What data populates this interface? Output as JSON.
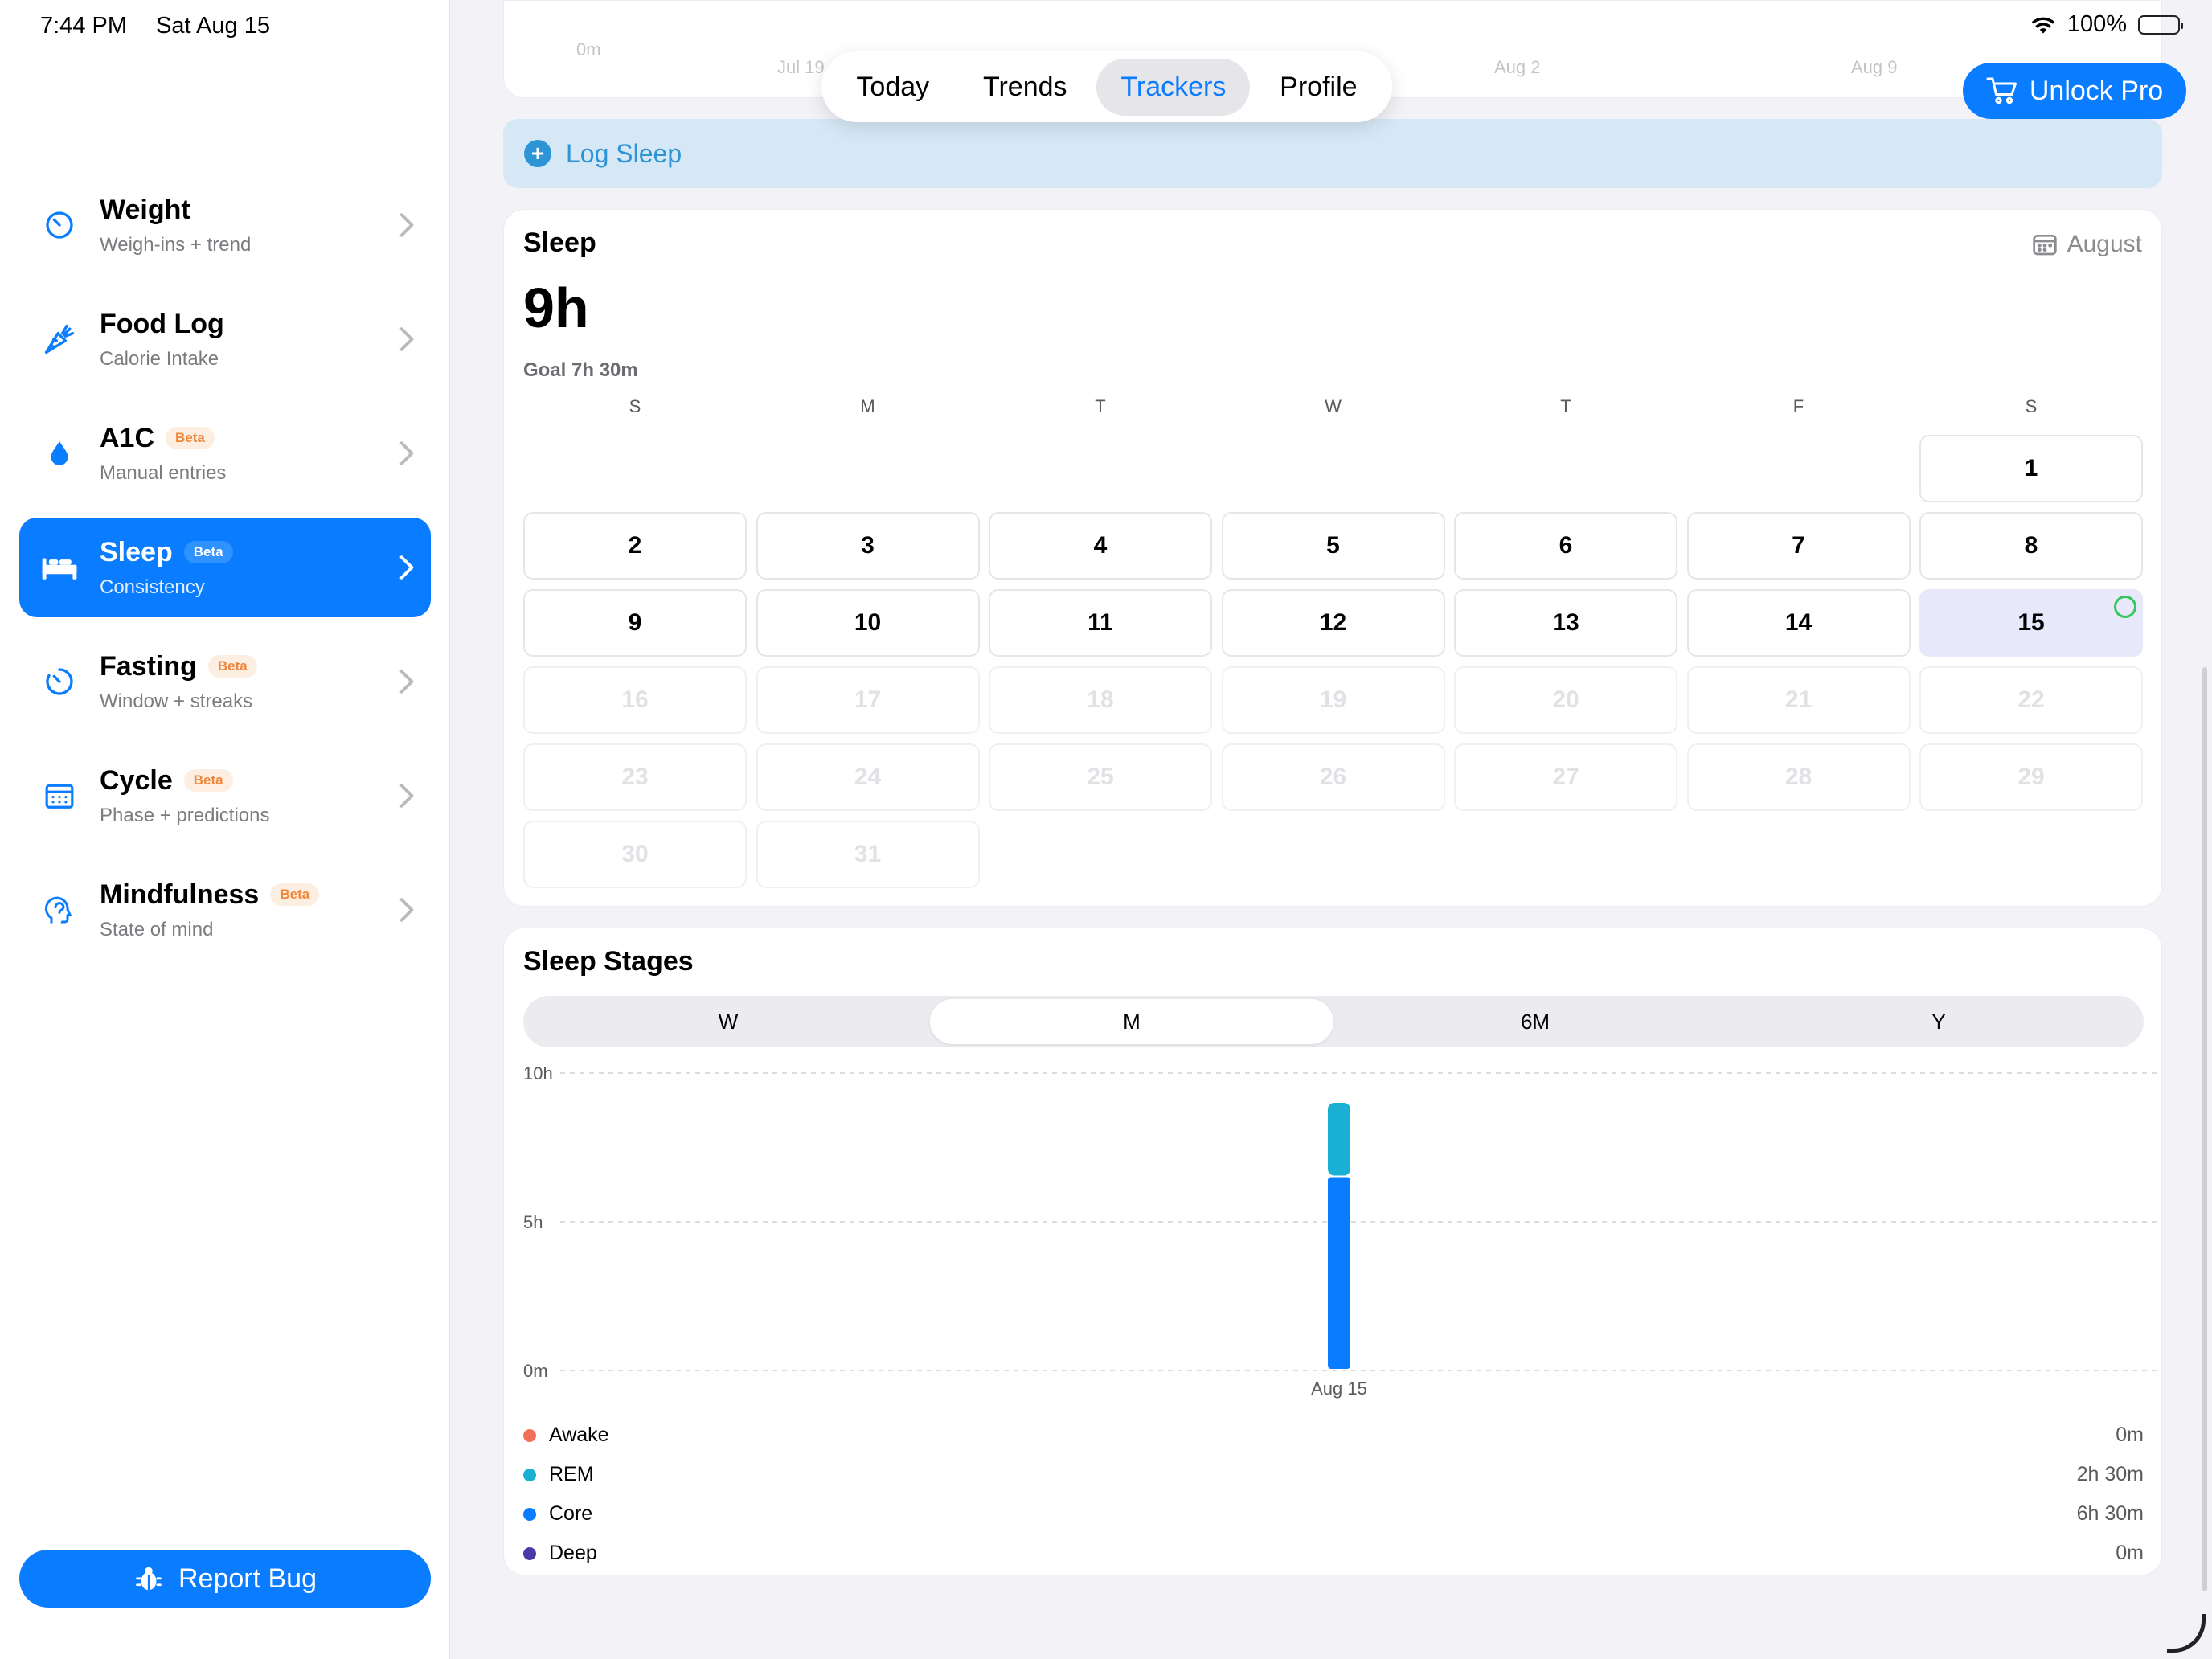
{
  "status": {
    "time": "7:44 PM",
    "date": "Sat Aug 15",
    "battery": "100%"
  },
  "sidebar": {
    "items": [
      {
        "title": "Weight",
        "subtitle": "Weigh-ins + trend",
        "badge": "",
        "icon": "gauge-icon"
      },
      {
        "title": "Food Log",
        "subtitle": "Calorie Intake",
        "badge": "",
        "icon": "carrot-icon"
      },
      {
        "title": "A1C",
        "subtitle": "Manual entries",
        "badge": "Beta",
        "icon": "drop-icon"
      },
      {
        "title": "Sleep",
        "subtitle": "Consistency",
        "badge": "Beta",
        "icon": "bed-icon"
      },
      {
        "title": "Fasting",
        "subtitle": "Window + streaks",
        "badge": "Beta",
        "icon": "timer-icon"
      },
      {
        "title": "Cycle",
        "subtitle": "Phase + predictions",
        "badge": "Beta",
        "icon": "calendar-icon"
      },
      {
        "title": "Mindfulness",
        "subtitle": "State of mind",
        "badge": "Beta",
        "icon": "head-icon"
      }
    ],
    "active_index": 3,
    "report_bug": "Report Bug"
  },
  "top_card": {
    "y_label": "0m",
    "x_labels": [
      "Jul 19",
      "Aug 2",
      "Aug 9"
    ]
  },
  "nav": {
    "tabs": [
      "Today",
      "Trends",
      "Trackers",
      "Profile"
    ],
    "active": "Trackers"
  },
  "unlock_pro": "Unlock Pro",
  "log_sleep": "Log Sleep",
  "sleep_card": {
    "title": "Sleep",
    "month": "August",
    "value": "9h",
    "goal": "Goal 7h 30m",
    "weekdays": [
      "S",
      "M",
      "T",
      "W",
      "T",
      "F",
      "S"
    ],
    "first_weekday_index": 6,
    "days_in_month": 31,
    "today": 15
  },
  "stages_card": {
    "title": "Sleep Stages",
    "ranges": [
      "W",
      "M",
      "6M",
      "Y"
    ],
    "active_range": "M"
  },
  "chart_data": {
    "type": "bar",
    "stacked": true,
    "categories": [
      "Aug 15"
    ],
    "series": [
      {
        "name": "Core",
        "values": [
          6.5
        ],
        "color": "#0a7cff"
      },
      {
        "name": "REM",
        "values": [
          2.5
        ],
        "color": "#19b0d4"
      }
    ],
    "y_ticks": [
      "0m",
      "5h",
      "10h"
    ],
    "ylim": [
      0,
      10
    ],
    "grid": true
  },
  "legend": [
    {
      "name": "Awake",
      "value": "0m",
      "color": "#f2705a"
    },
    {
      "name": "REM",
      "value": "2h 30m",
      "color": "#19b0d4"
    },
    {
      "name": "Core",
      "value": "6h 30m",
      "color": "#0a7cff"
    },
    {
      "name": "Deep",
      "value": "0m",
      "color": "#4a3aa8"
    }
  ]
}
